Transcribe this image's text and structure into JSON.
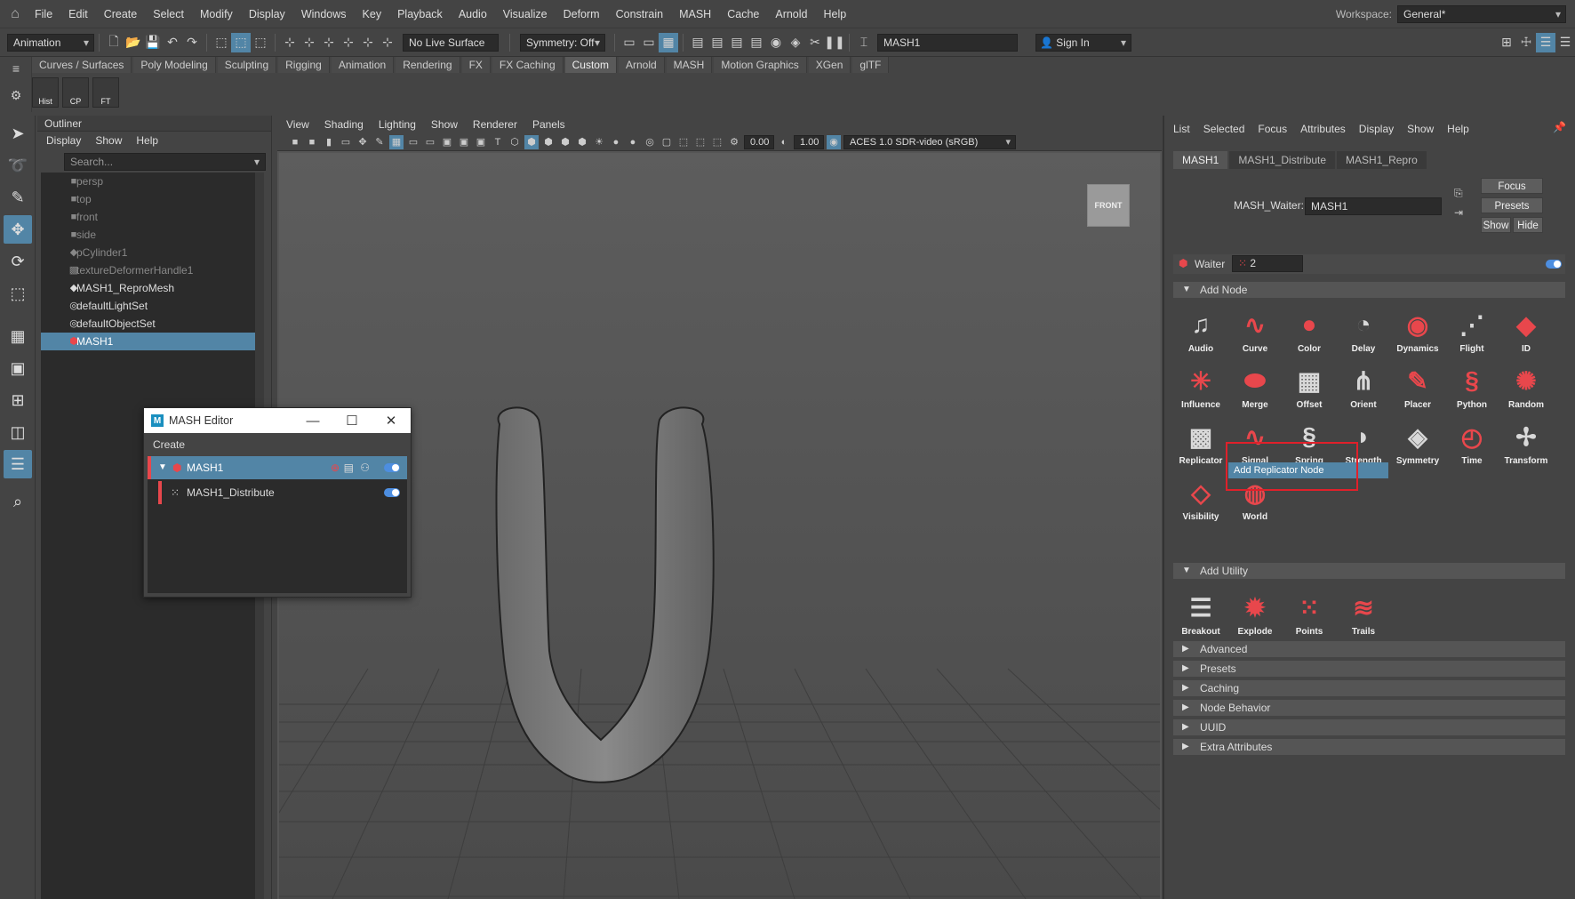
{
  "menubar": {
    "items": [
      "File",
      "Edit",
      "Create",
      "Select",
      "Modify",
      "Display",
      "Windows",
      "Key",
      "Playback",
      "Audio",
      "Visualize",
      "Deform",
      "Constrain",
      "MASH",
      "Cache",
      "Arnold",
      "Help"
    ],
    "workspace_label": "Workspace:",
    "workspace_value": "General*"
  },
  "statusline": {
    "mode": "Animation",
    "live_surface": "No Live Surface",
    "symmetry": "Symmetry: Off",
    "name_field": "MASH1",
    "sign_in": "Sign In"
  },
  "shelf": {
    "tabs": [
      "Curves / Surfaces",
      "Poly Modeling",
      "Sculpting",
      "Rigging",
      "Animation",
      "Rendering",
      "FX",
      "FX Caching",
      "Custom",
      "Arnold",
      "MASH",
      "Motion Graphics",
      "XGen",
      "glTF"
    ],
    "active_tab": "Custom",
    "buttons": [
      "Hist",
      "CP",
      "FT"
    ]
  },
  "outliner": {
    "title": "Outliner",
    "menus": [
      "Display",
      "Show",
      "Help"
    ],
    "search_placeholder": "Search...",
    "items": [
      {
        "label": "persp",
        "icon": "camera-icon",
        "dim": true
      },
      {
        "label": "top",
        "icon": "camera-icon",
        "dim": true
      },
      {
        "label": "front",
        "icon": "camera-icon",
        "dim": true
      },
      {
        "label": "side",
        "icon": "camera-icon",
        "dim": true
      },
      {
        "label": "pCylinder1",
        "icon": "mesh-icon",
        "dim": true
      },
      {
        "label": "textureDeformerHandle1",
        "icon": "deformer-icon",
        "dim": true
      },
      {
        "label": "MASH1_ReproMesh",
        "icon": "mesh-icon",
        "dim": false
      },
      {
        "label": "defaultLightSet",
        "icon": "set-icon",
        "dim": false
      },
      {
        "label": "defaultObjectSet",
        "icon": "set-icon",
        "dim": false
      },
      {
        "label": "MASH1",
        "icon": "mash-icon",
        "dim": false,
        "selected": true
      }
    ]
  },
  "viewport": {
    "menus": [
      "View",
      "Shading",
      "Lighting",
      "Show",
      "Renderer",
      "Panels"
    ],
    "field_a": "0.00",
    "field_b": "1.00",
    "color_space": "ACES 1.0 SDR-video (sRGB)",
    "view_cube_label": "FRONT"
  },
  "mash_editor": {
    "title": "MASH Editor",
    "menu": "Create",
    "rows": [
      {
        "label": "MASH1",
        "selected": true
      },
      {
        "label": "MASH1_Distribute",
        "selected": false
      }
    ]
  },
  "attribute_editor": {
    "menus": [
      "List",
      "Selected",
      "Focus",
      "Attributes",
      "Display",
      "Show",
      "Help"
    ],
    "tabs": [
      "MASH1",
      "MASH1_Distribute",
      "MASH1_Repro"
    ],
    "waiter_label": "MASH_Waiter:",
    "waiter_value": "MASH1",
    "buttons": {
      "focus": "Focus",
      "presets": "Presets",
      "show": "Show",
      "hide": "Hide"
    },
    "waiter_row_label": "Waiter",
    "waiter_count": "2",
    "add_node_header": "Add Node",
    "nodes": [
      {
        "label": "Audio",
        "icon": "audio-node-icon",
        "color": "gray"
      },
      {
        "label": "Curve",
        "icon": "curve-node-icon",
        "color": "red"
      },
      {
        "label": "Color",
        "icon": "color-node-icon",
        "color": "red"
      },
      {
        "label": "Delay",
        "icon": "delay-node-icon",
        "color": "gray"
      },
      {
        "label": "Dynamics",
        "icon": "dynamics-node-icon",
        "color": "red"
      },
      {
        "label": "Flight",
        "icon": "flight-node-icon",
        "color": "gray"
      },
      {
        "label": "ID",
        "icon": "id-node-icon",
        "color": "red"
      },
      {
        "label": "Influence",
        "icon": "influence-node-icon",
        "color": "red"
      },
      {
        "label": "Merge",
        "icon": "merge-node-icon",
        "color": "red"
      },
      {
        "label": "Offset",
        "icon": "offset-node-icon",
        "color": "gray"
      },
      {
        "label": "Orient",
        "icon": "orient-node-icon",
        "color": "gray"
      },
      {
        "label": "Placer",
        "icon": "placer-node-icon",
        "color": "red"
      },
      {
        "label": "Python",
        "icon": "python-node-icon",
        "color": "red"
      },
      {
        "label": "Random",
        "icon": "random-node-icon",
        "color": "red"
      },
      {
        "label": "Replicator",
        "icon": "replicator-node-icon",
        "color": "gray"
      },
      {
        "label": "Signal",
        "icon": "signal-node-icon",
        "color": "red"
      },
      {
        "label": "Spring",
        "icon": "spring-node-icon",
        "color": "gray"
      },
      {
        "label": "Strength",
        "icon": "strength-node-icon",
        "color": "gray"
      },
      {
        "label": "Symmetry",
        "icon": "symmetry-node-icon",
        "color": "gray"
      },
      {
        "label": "Time",
        "icon": "time-node-icon",
        "color": "red"
      },
      {
        "label": "Transform",
        "icon": "transform-node-icon",
        "color": "gray"
      },
      {
        "label": "Visibility",
        "icon": "visibility-node-icon",
        "color": "red"
      },
      {
        "label": "World",
        "icon": "world-node-icon",
        "color": "red"
      }
    ],
    "tooltip": "Add Replicator Node",
    "add_utility_header": "Add Utility",
    "utilities": [
      {
        "label": "Breakout",
        "icon": "breakout-icon",
        "color": "gray"
      },
      {
        "label": "Explode",
        "icon": "explode-icon",
        "color": "red"
      },
      {
        "label": "Points",
        "icon": "points-icon",
        "color": "red"
      },
      {
        "label": "Trails",
        "icon": "trails-icon",
        "color": "red"
      }
    ],
    "collapsed_sections": [
      "Advanced",
      "Presets",
      "Caching",
      "Node Behavior",
      "UUID",
      "Extra Attributes"
    ]
  },
  "colors": {
    "accent": "#5285a6",
    "mash_red": "#e8474c",
    "highlight_box": "#e0202a"
  }
}
